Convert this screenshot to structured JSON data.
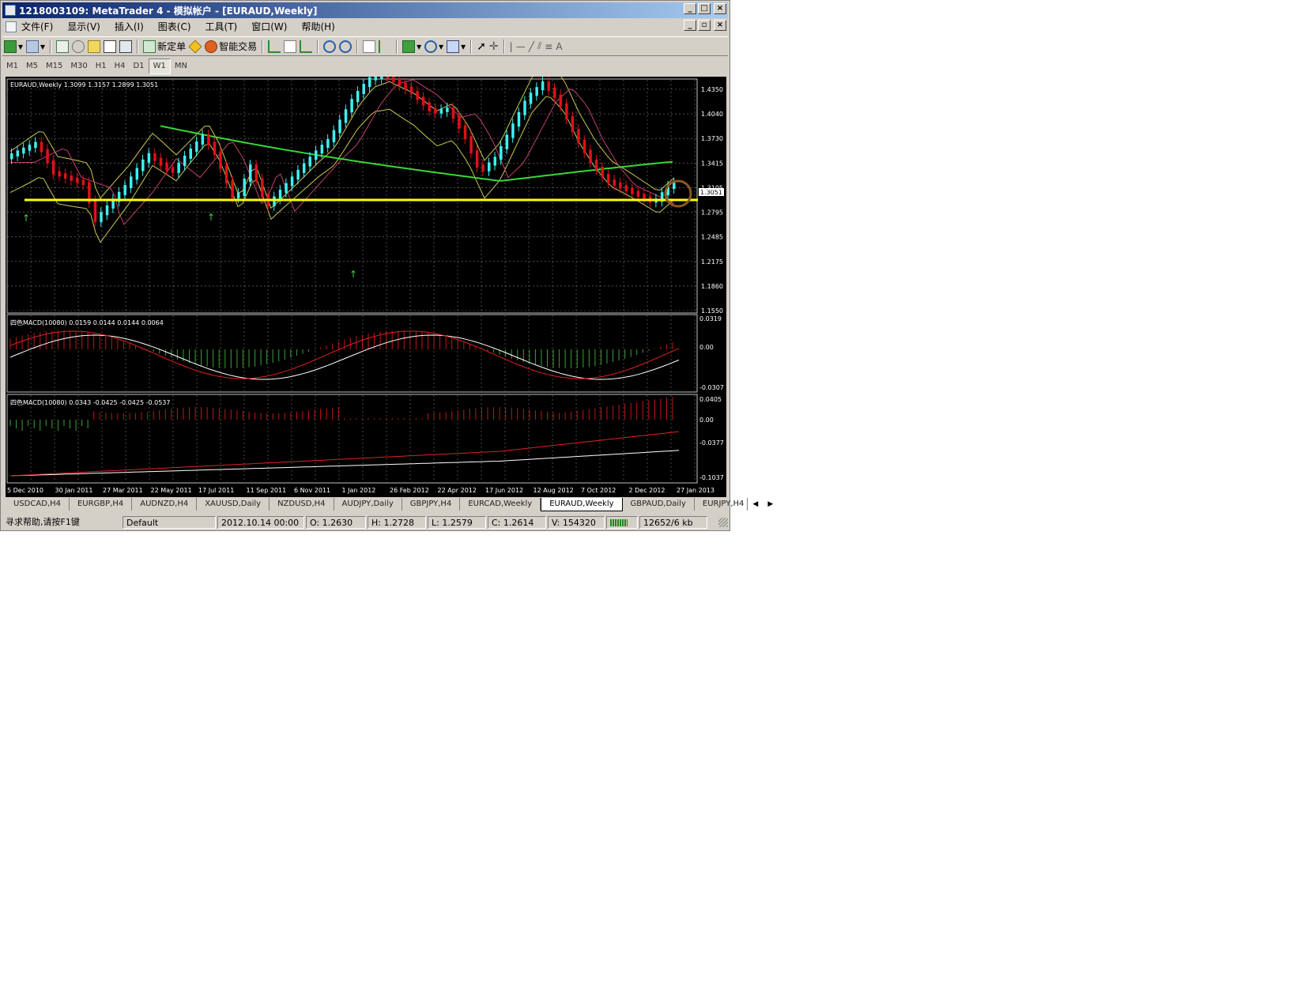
{
  "window": {
    "title": "1218003109: MetaTrader 4 - 模拟帐户 - [EURAUD,Weekly]"
  },
  "menu": {
    "items": [
      "文件(F)",
      "显示(V)",
      "插入(I)",
      "图表(C)",
      "工具(T)",
      "窗口(W)",
      "帮助(H)"
    ]
  },
  "toolbar": {
    "new_order_label": "新定单",
    "expert_trading_label": "智能交易",
    "text_tool_label": "A"
  },
  "timeframes": {
    "items": [
      "M1",
      "M5",
      "M15",
      "M30",
      "H1",
      "H4",
      "D1",
      "W1",
      "MN"
    ],
    "active": "W1"
  },
  "chart": {
    "header": "EURAUD,Weekly  1.3099 1.3157 1.2899 1.3051",
    "price_ticks": [
      "1.4350",
      "1.4040",
      "1.3730",
      "1.3415",
      "1.3105",
      "1.2795",
      "1.2485",
      "1.2175",
      "1.1860",
      "1.1550"
    ],
    "current_price": "1.3051",
    "colors": {
      "bull_candle": "#3ff0f0",
      "bear_candle": "#e0101a",
      "support_line": "#ffff00",
      "ma_green": "#38d838",
      "band_yellow": "#c8c850",
      "band_mid": "#c04070",
      "grid": "#7a7a7a"
    },
    "macd1": {
      "header": "四色MACD(10080) 0.0159 0.0144 0.0144 0.0064",
      "ticks": [
        "0.0319",
        "0.00",
        "-0.0307"
      ]
    },
    "macd2": {
      "header": "四色MACD(10080) 0.0343 -0.0425 -0.0425 -0.0537",
      "ticks": [
        "0.0405",
        "0.00",
        "-0.0377",
        "-0.1037"
      ]
    },
    "date_ticks": [
      "5 Dec 2010",
      "30 Jan 2011",
      "27 Mar 2011",
      "22 May 2011",
      "17 Jul 2011",
      "11 Sep 2011",
      "6 Nov 2011",
      "1 Jan 2012",
      "26 Feb 2012",
      "22 Apr 2012",
      "17 Jun 2012",
      "12 Aug 2012",
      "7 Oct 2012",
      "2 Dec 2012",
      "27 Jan 2013"
    ]
  },
  "tabs": {
    "items": [
      "USDCAD,H4",
      "EURGBP,H4",
      "AUDNZD,H4",
      "XAUUSD,Daily",
      "NZDUSD,H4",
      "AUDJPY,Daily",
      "GBPJPY,H4",
      "EURCAD,Weekly",
      "EURAUD,Weekly",
      "GBPAUD,Daily",
      "EURJPY,H4"
    ],
    "active": "EURAUD,Weekly"
  },
  "status": {
    "help": "寻求帮助,请按F1键",
    "profile": "Default",
    "datetime": "2012.10.14 00:00",
    "open": "O: 1.2630",
    "high": "H: 1.2728",
    "low": "L: 1.2579",
    "close": "C: 1.2614",
    "volume": "V: 154320",
    "traffic": "12652/6 kb"
  }
}
